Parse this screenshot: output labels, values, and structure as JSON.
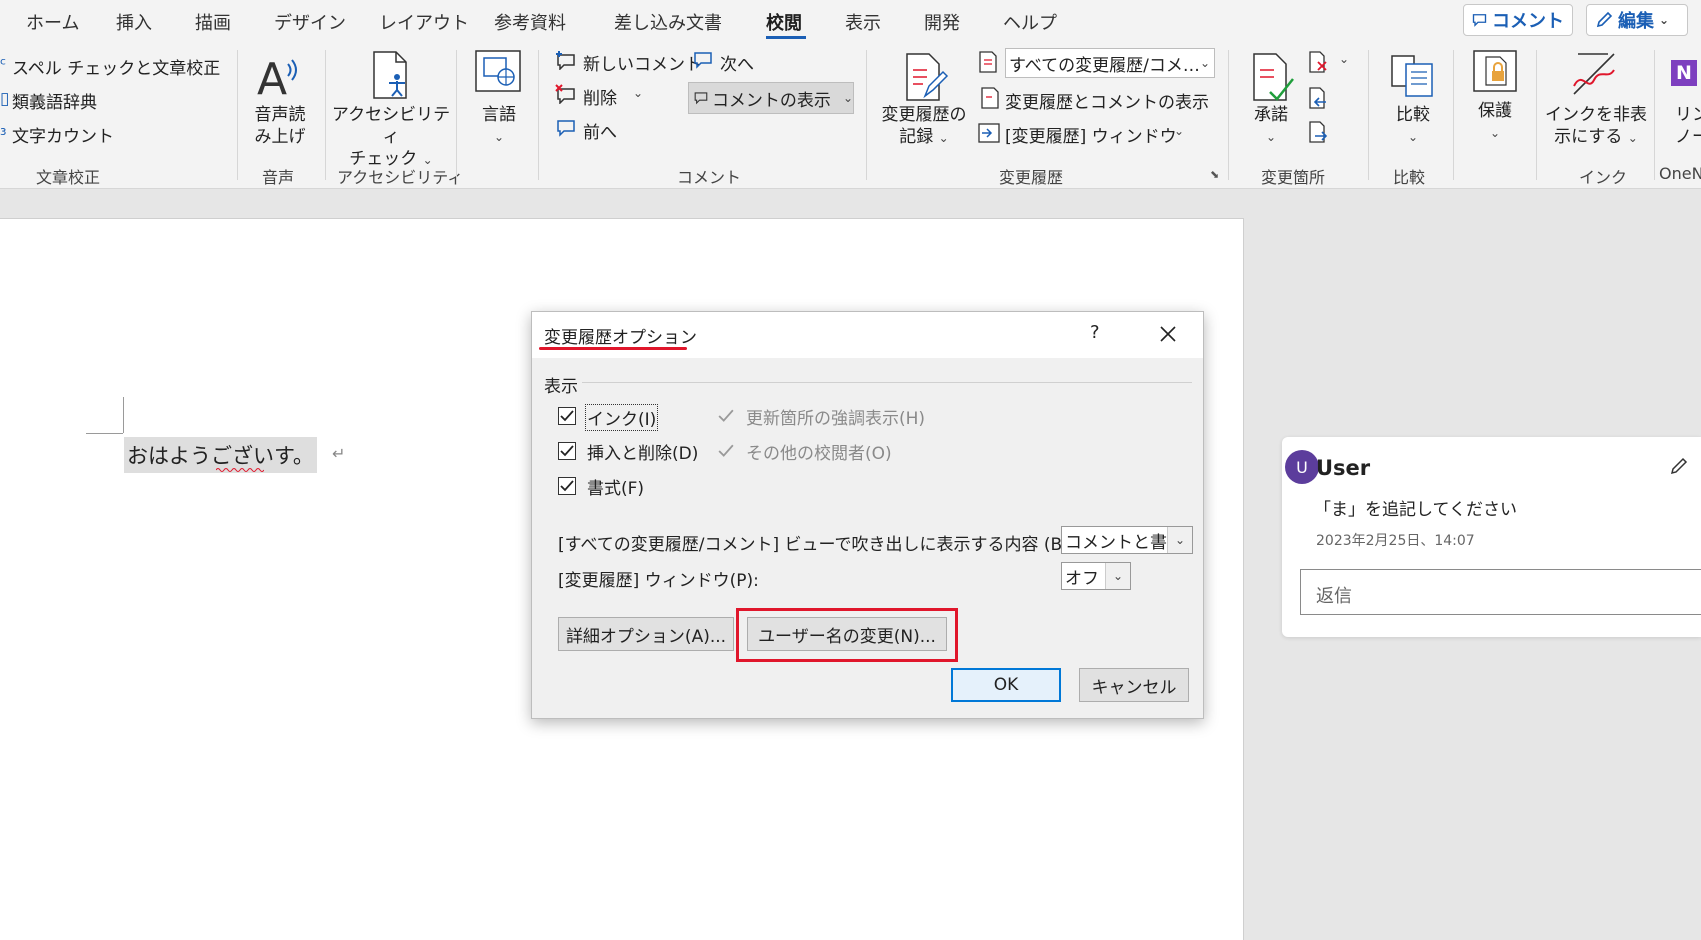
{
  "tabs": [
    "ホーム",
    "挿入",
    "描画",
    "デザイン",
    "レイアウト",
    "参考資料",
    "差し込み文書",
    "校閲",
    "表示",
    "開発",
    "ヘルプ"
  ],
  "top_buttons": {
    "comment": "コメント",
    "edit": "編集"
  },
  "ribbon": {
    "proofing": {
      "spell": "スペル チェックと文章校正",
      "thesaurus": "類義語辞典",
      "wordcount": "文字カウント",
      "label": "文章校正"
    },
    "speech": {
      "read_aloud_1": "音声読",
      "read_aloud_2": "み上げ",
      "label": "音声"
    },
    "accessibility": {
      "check_1": "アクセシビリティ",
      "check_2": "チェック",
      "label": "アクセシビリティ"
    },
    "language": {
      "lang": "言語"
    },
    "comments": {
      "new": "新しいコメント",
      "delete": "削除",
      "prev": "前へ",
      "next": "次へ",
      "show": "コメントの表示",
      "label": "コメント"
    },
    "tracking": {
      "track_1": "変更履歴の",
      "track_2": "記録",
      "markup": "すべての変更履歴/コメ…",
      "show_markup": "変更履歴とコメントの表示",
      "pane": "[変更履歴] ウィンドウ",
      "label": "変更履歴"
    },
    "changes": {
      "accept": "承諾",
      "label": "変更箇所"
    },
    "compare": {
      "compare": "比較",
      "label": "比較"
    },
    "protect": {
      "protect": "保護"
    },
    "ink": {
      "hide_1": "インクを非表",
      "hide_2": "示にする",
      "label": "インク"
    },
    "onenote": {
      "link_1": "リン",
      "link_2": "ノー",
      "label": "OneN"
    }
  },
  "document": {
    "text": "おはようございす。"
  },
  "comment": {
    "avatar": "U",
    "user": "User",
    "text": "「ま」を追記してください",
    "date": "2023年2月25日、14:07",
    "reply_placeholder": "返信"
  },
  "dialog": {
    "title": "変更履歴オプション",
    "help": "?",
    "section": "表示",
    "checkboxes": {
      "ink": "インク(I)",
      "insdel": "挿入と削除(D)",
      "format": "書式(F)",
      "highlight": "更新箇所の強調表示(H)",
      "other": "その他の校閲者(O)"
    },
    "balloon_label": "[すべての変更履歴/コメント] ビューで吹き出しに表示する内容 (B):",
    "balloon_value": "コメントと書式",
    "pane_label": "[変更履歴] ウィンドウ(P):",
    "pane_value": "オフ",
    "advanced": "詳細オプション(A)...",
    "username": "ユーザー名の変更(N)...",
    "ok": "OK",
    "cancel": "キャンセル"
  },
  "colors": {
    "accent": "#1b5fb5",
    "highlight_red": "#e0162b",
    "avatar": "#5c3d9c"
  }
}
